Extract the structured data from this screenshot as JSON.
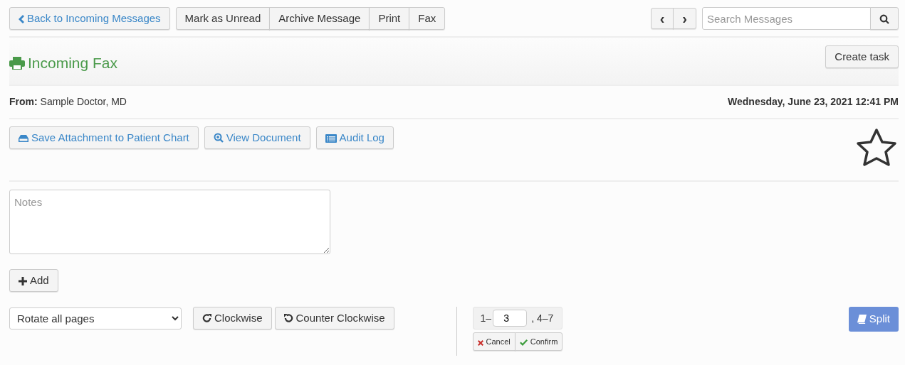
{
  "toolbar": {
    "back": "Back to Incoming Messages",
    "actions": [
      "Mark as Unread",
      "Archive Message",
      "Print",
      "Fax"
    ],
    "prev": "‹",
    "next": "›",
    "search": {
      "placeholder": "Search Messages"
    }
  },
  "header": {
    "title": "Incoming Fax",
    "create_task": "Create task"
  },
  "message": {
    "from_label": "From:",
    "from": "Sample Doctor, MD",
    "date": "Wednesday, June 23, 2021 12:41 PM",
    "starred": false
  },
  "attachment_buttons": [
    {
      "kind": "save",
      "label": "Save Attachment to Patient Chart"
    },
    {
      "kind": "view",
      "label": "View Document"
    },
    {
      "kind": "audit",
      "label": "Audit Log"
    }
  ],
  "notes": {
    "placeholder": "Notes",
    "add": "Add"
  },
  "rotate": {
    "select": "Rotate all pages",
    "clockwise": "Clockwise",
    "counter": "Counter Clockwise"
  },
  "split": {
    "prefix": "1–",
    "value": "3",
    "suffix": ", 4–7",
    "cancel": "Cancel",
    "confirm": "Confirm",
    "button": "Split"
  }
}
